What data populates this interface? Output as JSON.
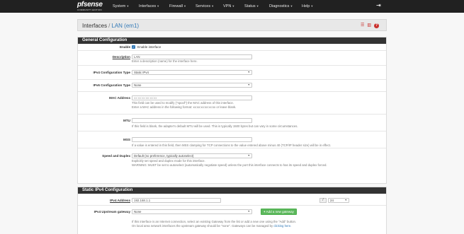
{
  "brand": {
    "name": "sense",
    "prefix": "pf",
    "edition": "COMMUNITY EDITION"
  },
  "nav": [
    {
      "label": "System"
    },
    {
      "label": "Interfaces"
    },
    {
      "label": "Firewall"
    },
    {
      "label": "Services"
    },
    {
      "label": "VPN"
    },
    {
      "label": "Status"
    },
    {
      "label": "Diagnostics"
    },
    {
      "label": "Help"
    }
  ],
  "breadcrumb": {
    "parent": "Interfaces",
    "separator": "/",
    "current": "LAN (em1)"
  },
  "general": {
    "title": "General Configuration",
    "enable": {
      "label": "Enable",
      "checkbox_label": "Enable interface",
      "checked": true
    },
    "description": {
      "label": "Description",
      "value": "LAN",
      "help": "Enter a description (name) for the interface here."
    },
    "ipv4_type": {
      "label": "IPv4 Configuration Type",
      "value": "Static IPv4"
    },
    "ipv6_type": {
      "label": "IPv6 Configuration Type",
      "value": "None"
    },
    "mac": {
      "label": "MAC Address",
      "placeholder": "xx:xx:xx:xx:xx:xx",
      "help1": "This field can be used to modify (\"spoof\") the MAC address of this interface.",
      "help2": "Enter a MAC address in the following format: xx:xx:xx:xx:xx:xx or leave blank."
    },
    "mtu": {
      "label": "MTU",
      "help": "If this field is blank, the adapter's default MTU will be used. This is typically 1500 bytes but can vary in some circumstances."
    },
    "mss": {
      "label": "MSS",
      "help": "If a value is entered in this field, then MSS clamping for TCP connections to the value entered above minus 40 (TCP/IP header size) will be in effect."
    },
    "speed": {
      "label": "Speed and Duplex",
      "value": "Default (no preference, typically autoselect)",
      "help1": "Explicitly set speed and duplex mode for this interface.",
      "help2": "WARNING: MUST be set to autoselect (automatically negotiate speed) unless the port this interface connects to has its speed and duplex forced."
    }
  },
  "static": {
    "title": "Static IPv4 Configuration",
    "address": {
      "label": "IPv4 Address",
      "value": "192.168.1.1",
      "slash": "/",
      "cidr": "24"
    },
    "gateway": {
      "label": "IPv4 Upstream gateway",
      "value": "None",
      "button": "Add a new gateway",
      "help1": "If this interface is an Internet connection, select an existing Gateway from the list or add a new one using the \"Add\" button.",
      "help2": "On local area network interfaces the upstream gateway should be \"none\". Gateways can be managed by",
      "help2_link": "clicking here."
    }
  }
}
